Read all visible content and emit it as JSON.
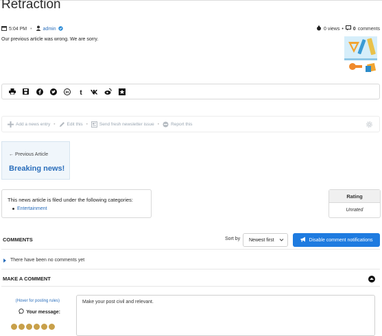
{
  "article": {
    "title": "Retraction",
    "time": "5:04 PM",
    "author": "admin",
    "views": "0 views",
    "comments_count": "0",
    "comments_label": "comments",
    "lead": "Our previous article was wrong. We are sorry."
  },
  "share": {
    "icons": [
      "print-icon",
      "save-icon",
      "facebook-icon",
      "twitter-icon",
      "linkedin-icon",
      "tumblr-icon",
      "vk-icon",
      "weibo-icon",
      "favorite-icon"
    ]
  },
  "actions": {
    "add": "Add a news entry",
    "edit": "Edit this",
    "newsletter": "Send fresh newsletter issue",
    "report": "Report this"
  },
  "prev_article": {
    "label": "← Previous Article",
    "title": "Breaking news!"
  },
  "categories": {
    "text": "This news article is filed under the following categories:",
    "items": [
      "Entertainment"
    ]
  },
  "rating": {
    "header": "Rating",
    "value": "Unrated"
  },
  "comments": {
    "header": "COMMENTS",
    "sort_label": "Sort by",
    "sort_value": "Newest first",
    "notify_button": "Disable comment notifications",
    "empty": "There have been no comments yet"
  },
  "make_comment": {
    "header": "MAKE A COMMENT",
    "hover_rules": "(Hover for posting rules)",
    "your_message": "Your message:",
    "placeholder": "Make your post civil and relevant."
  },
  "colors": {
    "link": "#2a6ebb",
    "button": "#1e7be0",
    "prev_bg": "#f0f6fb"
  }
}
